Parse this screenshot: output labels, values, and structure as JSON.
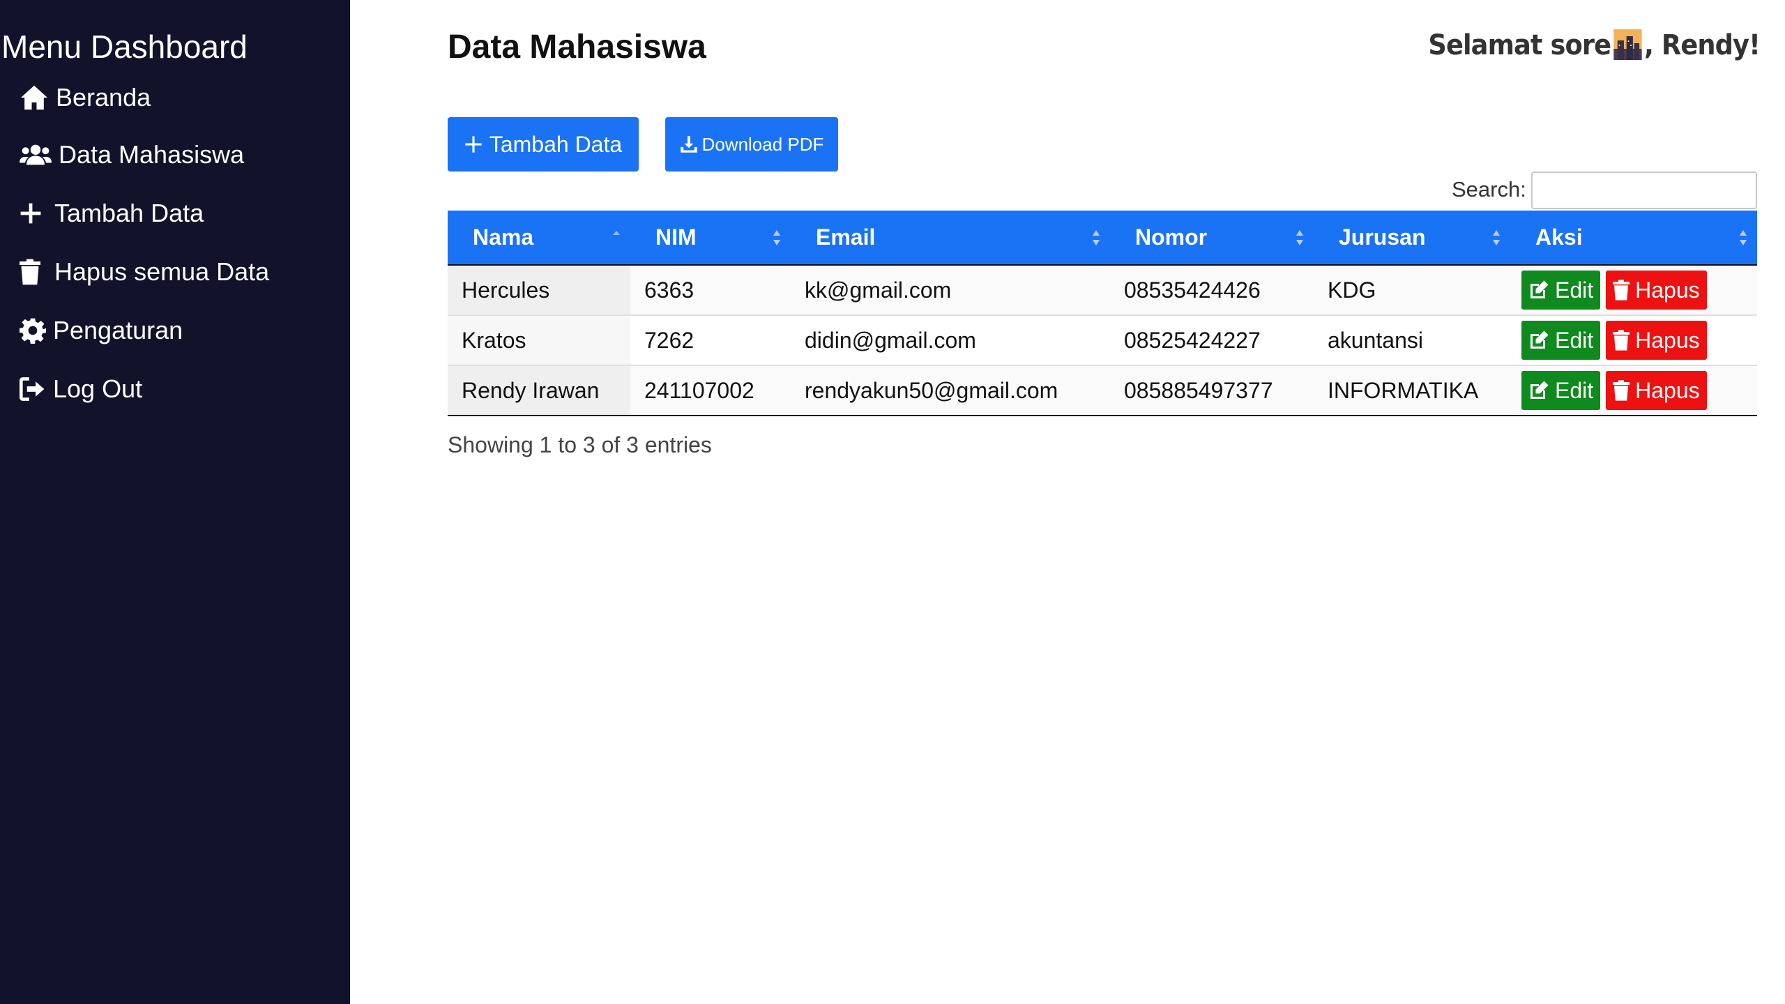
{
  "sidebar": {
    "title": "Menu Dashboard",
    "items": [
      {
        "label": "Beranda",
        "icon": "home-icon"
      },
      {
        "label": "Data Mahasiswa",
        "icon": "users-icon"
      },
      {
        "label": "Tambah Data",
        "icon": "plus-icon"
      },
      {
        "label": "Hapus semua Data",
        "icon": "trash-icon"
      },
      {
        "label": "Pengaturan",
        "icon": "gear-icon"
      },
      {
        "label": "Log Out",
        "icon": "logout-icon"
      }
    ]
  },
  "header": {
    "title": "Data Mahasiswa",
    "greeting_prefix": "Selamat sore",
    "greeting_suffix": ", Rendy!"
  },
  "toolbar": {
    "add_label": "Tambah Data",
    "pdf_label": "Download PDF",
    "search_label": "Search:",
    "search_value": ""
  },
  "table": {
    "columns": [
      "Nama",
      "NIM",
      "Email",
      "Nomor",
      "Jurusan",
      "Aksi"
    ],
    "rows": [
      {
        "nama": "Hercules",
        "nim": "6363",
        "email": "kk@gmail.com",
        "nomor": "08535424426",
        "jurusan": "KDG"
      },
      {
        "nama": "Kratos",
        "nim": "7262",
        "email": "didin@gmail.com",
        "nomor": "08525424227",
        "jurusan": "akuntansi"
      },
      {
        "nama": "Rendy Irawan",
        "nim": "241107002",
        "email": "rendyakun50@gmail.com",
        "nomor": "085885497377",
        "jurusan": "INFORMATIKA"
      }
    ],
    "edit_label": "Edit",
    "delete_label": "Hapus"
  },
  "footer": {
    "info": "Showing 1 to 3 of 3 entries"
  },
  "colors": {
    "sidebar_bg": "#12122a",
    "primary": "#1a73f5",
    "edit": "#0f8a1e",
    "delete": "#ee1111"
  }
}
